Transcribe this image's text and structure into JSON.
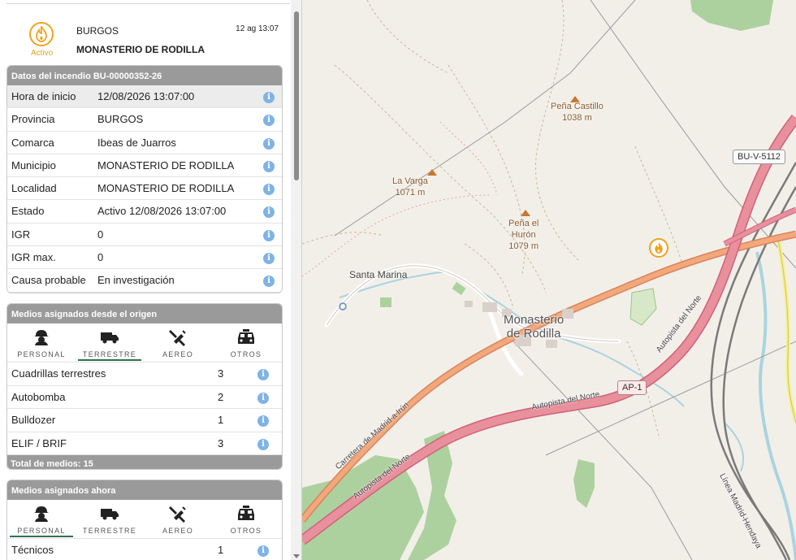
{
  "incident": {
    "status": "Activo",
    "province": "BURGOS",
    "municipality": "MONASTERIO DE RODILLA",
    "time": "12 ag 13:07"
  },
  "details": {
    "title": "Datos del incendio BU-00000352-26",
    "rows": [
      {
        "label": "Hora de inicio",
        "value": "12/08/2026 13:07:00"
      },
      {
        "label": "Provincia",
        "value": "BURGOS"
      },
      {
        "label": "Comarca",
        "value": "Ibeas de Juarros"
      },
      {
        "label": "Municipio",
        "value": "MONASTERIO DE RODILLA"
      },
      {
        "label": "Localidad",
        "value": "MONASTERIO DE RODILLA"
      },
      {
        "label": "Estado",
        "value": "Activo 12/08/2026 13:07:00"
      },
      {
        "label": "IGR",
        "value": "0"
      },
      {
        "label": "IGR max.",
        "value": "0"
      },
      {
        "label": "Causa probable",
        "value": "En investigación"
      }
    ],
    "info_glyph": "i"
  },
  "origin_resources": {
    "title": "Medios asignados desde el origen",
    "tabs": [
      "PERSONAL",
      "TERRESTRE",
      "AEREO",
      "OTROS"
    ],
    "active_tab": "TERRESTRE",
    "rows": [
      {
        "label": "Cuadrillas terrestres",
        "count": "3"
      },
      {
        "label": "Autobomba",
        "count": "2"
      },
      {
        "label": "Bulldozer",
        "count": "1"
      },
      {
        "label": "ELIF / BRIF",
        "count": "3"
      }
    ],
    "total": "Total de medios: 15"
  },
  "current_resources": {
    "title": "Medios asignados ahora",
    "tabs": [
      "PERSONAL",
      "TERRESTRE",
      "AEREO",
      "OTROS"
    ],
    "active_tab": "PERSONAL",
    "rows": [
      {
        "label": "Técnicos",
        "count": "1"
      }
    ]
  },
  "map": {
    "labels": {
      "pena_castillo": "Peña Castillo",
      "pena_castillo_alt": "1038 m",
      "la_varga": "La Varga",
      "la_varga_alt": "1071 m",
      "pena_huron_1": "Peña el",
      "pena_huron_2": "Hurón",
      "pena_huron_alt": "1079 m",
      "santa_marina": "Santa Marina",
      "town_1": "Monasterio",
      "town_2": "de Rodilla",
      "road_bu": "BU-V-5112",
      "road_ap": "AP-1",
      "autopista_1": "Autopista del Norte",
      "autopista_2": "Autopista del Norte",
      "autopista_3": "Autopista del Norte",
      "carretera": "Carretera de Madrid a Irún",
      "linea": "Línea Madrid-Hendaya"
    },
    "colors": {
      "background": "#f2efe9",
      "motorway": "#e8909c",
      "trunk": "#f2a87a",
      "forest": "#add19e",
      "water": "#aad3df",
      "rail": "#777777",
      "fire": "#f1a31b"
    }
  }
}
